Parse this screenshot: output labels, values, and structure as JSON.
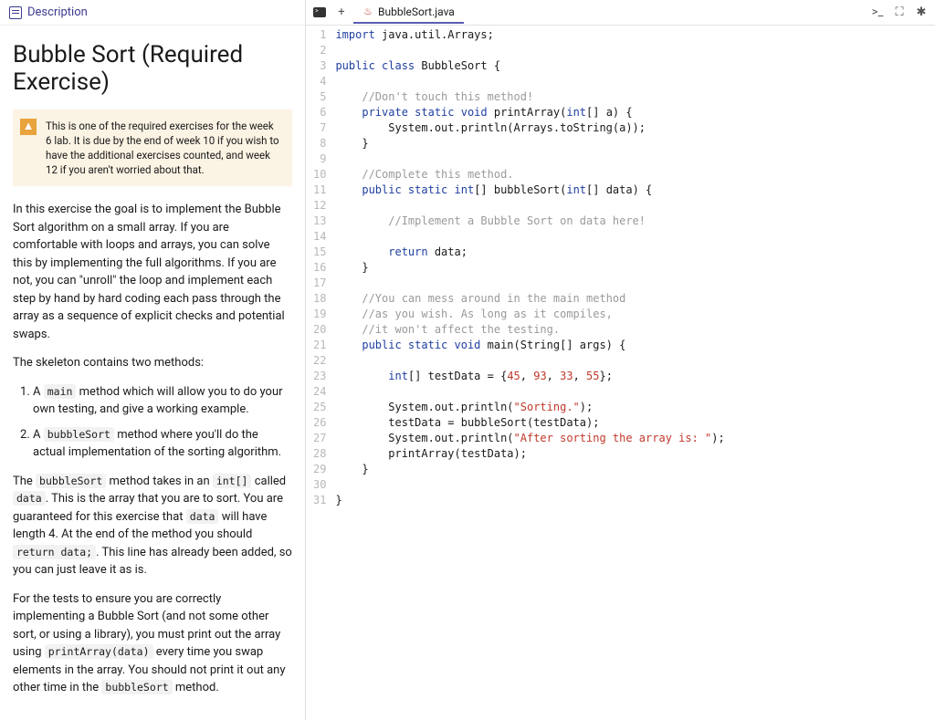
{
  "description": {
    "header": "Description",
    "title": "Bubble Sort (Required Exercise)",
    "warning_icon": "⚠",
    "warning": "This is one of the required exercises for the week 6 lab. It is due by the end of week 10 if you wish to have the additional exercises counted, and week 12 if you aren't worried about that.",
    "para1": "In this exercise the goal is to implement the Bubble Sort algorithm on a small array. If you are comfortable with loops and arrays, you can solve this by implementing the full algorithms. If you are not, you can \"unroll\" the loop and implement each step by hand by hard coding each pass through the array as a sequence of explicit checks and potential swaps.",
    "para2": "The skeleton contains two methods:",
    "li1a": "A ",
    "li1_code": "main",
    "li1b": " method which will allow you to do your own testing, and give a working example.",
    "li2a": "A ",
    "li2_code": "bubbleSort",
    "li2b": " method where you'll do the actual implementation of the sorting algorithm.",
    "p3a": "The ",
    "p3c1": "bubbleSort",
    "p3b": " method takes in an ",
    "p3c2": "int[]",
    "p3c": " called ",
    "p3c3": "data",
    "p3d": ". This is the array that you are to sort. You are guaranteed for this exercise that ",
    "p3c4": "data",
    "p3e": " will have length 4. At the end of the method you should ",
    "p3c5": "return data;",
    "p3f": ". This line has already been added, so you can just leave it as is.",
    "p4a": "For the tests to ensure you are correctly implementing a Bubble Sort (and not some other sort, or using a library), you must print out the array using ",
    "p4c1": "printArray(data)",
    "p4b": " every time you swap elements in the array. You should not print it out any other time in the ",
    "p4c2": "bubbleSort",
    "p4c": " method."
  },
  "tabbar": {
    "active_tab": "BubbleSort.java",
    "plus": "+",
    "console": ">_",
    "fullscreen": "⛶",
    "settings": "✱"
  },
  "code": {
    "lines": 31,
    "src": [
      {
        "n": 1,
        "t": [
          [
            "kw",
            "import"
          ],
          [
            "",
            " java.util.Arrays;"
          ]
        ]
      },
      {
        "n": 2,
        "t": [
          [
            "",
            ""
          ]
        ]
      },
      {
        "n": 3,
        "t": [
          [
            "kw",
            "public class"
          ],
          [
            "",
            " BubbleSort {"
          ]
        ]
      },
      {
        "n": 4,
        "t": [
          [
            "",
            ""
          ]
        ]
      },
      {
        "n": 5,
        "t": [
          [
            "",
            "    "
          ],
          [
            "cm",
            "//Don't touch this method!"
          ]
        ]
      },
      {
        "n": 6,
        "t": [
          [
            "",
            "    "
          ],
          [
            "kw",
            "private static void"
          ],
          [
            "",
            " printArray("
          ],
          [
            "kw",
            "int"
          ],
          [
            "",
            "[] a) {"
          ]
        ]
      },
      {
        "n": 7,
        "t": [
          [
            "",
            "        System.out.println(Arrays.toString(a));"
          ]
        ]
      },
      {
        "n": 8,
        "t": [
          [
            "",
            "    }"
          ]
        ]
      },
      {
        "n": 9,
        "t": [
          [
            "",
            ""
          ]
        ]
      },
      {
        "n": 10,
        "t": [
          [
            "",
            "    "
          ],
          [
            "cm",
            "//Complete this method."
          ]
        ]
      },
      {
        "n": 11,
        "t": [
          [
            "",
            "    "
          ],
          [
            "kw",
            "public static int"
          ],
          [
            "",
            "[] bubbleSort("
          ],
          [
            "kw",
            "int"
          ],
          [
            "",
            "[] data) {"
          ]
        ]
      },
      {
        "n": 12,
        "t": [
          [
            "",
            ""
          ]
        ]
      },
      {
        "n": 13,
        "t": [
          [
            "",
            "        "
          ],
          [
            "cm",
            "//Implement a Bubble Sort on data here!"
          ]
        ]
      },
      {
        "n": 14,
        "t": [
          [
            "",
            ""
          ]
        ]
      },
      {
        "n": 15,
        "t": [
          [
            "",
            "        "
          ],
          [
            "kw",
            "return"
          ],
          [
            "",
            " data;"
          ]
        ]
      },
      {
        "n": 16,
        "t": [
          [
            "",
            "    }"
          ]
        ]
      },
      {
        "n": 17,
        "t": [
          [
            "",
            ""
          ]
        ]
      },
      {
        "n": 18,
        "t": [
          [
            "",
            "    "
          ],
          [
            "cm",
            "//You can mess around in the main method"
          ]
        ]
      },
      {
        "n": 19,
        "t": [
          [
            "",
            "    "
          ],
          [
            "cm",
            "//as you wish. As long as it compiles,"
          ]
        ]
      },
      {
        "n": 20,
        "t": [
          [
            "",
            "    "
          ],
          [
            "cm",
            "//it won't affect the testing."
          ]
        ]
      },
      {
        "n": 21,
        "t": [
          [
            "",
            "    "
          ],
          [
            "kw",
            "public static void"
          ],
          [
            "",
            " main(String[] args) {"
          ]
        ]
      },
      {
        "n": 22,
        "t": [
          [
            "",
            ""
          ]
        ]
      },
      {
        "n": 23,
        "t": [
          [
            "",
            "        "
          ],
          [
            "kw",
            "int"
          ],
          [
            "",
            "[] testData = {"
          ],
          [
            "num",
            "45"
          ],
          [
            "",
            ", "
          ],
          [
            "num",
            "93"
          ],
          [
            "",
            ", "
          ],
          [
            "num",
            "33"
          ],
          [
            "",
            ", "
          ],
          [
            "num",
            "55"
          ],
          [
            "",
            "};"
          ]
        ]
      },
      {
        "n": 24,
        "t": [
          [
            "",
            ""
          ]
        ]
      },
      {
        "n": 25,
        "t": [
          [
            "",
            "        System.out.println("
          ],
          [
            "str",
            "\"Sorting.\""
          ],
          [
            "",
            ");"
          ]
        ]
      },
      {
        "n": 26,
        "t": [
          [
            "",
            "        testData = bubbleSort(testData);"
          ]
        ]
      },
      {
        "n": 27,
        "t": [
          [
            "",
            "        System.out.println("
          ],
          [
            "str",
            "\"After sorting the array is: \""
          ],
          [
            "",
            ");"
          ]
        ]
      },
      {
        "n": 28,
        "t": [
          [
            "",
            "        printArray(testData);"
          ]
        ]
      },
      {
        "n": 29,
        "t": [
          [
            "",
            "    }"
          ]
        ]
      },
      {
        "n": 30,
        "t": [
          [
            "",
            ""
          ]
        ]
      },
      {
        "n": 31,
        "t": [
          [
            "",
            "}"
          ]
        ]
      }
    ]
  }
}
